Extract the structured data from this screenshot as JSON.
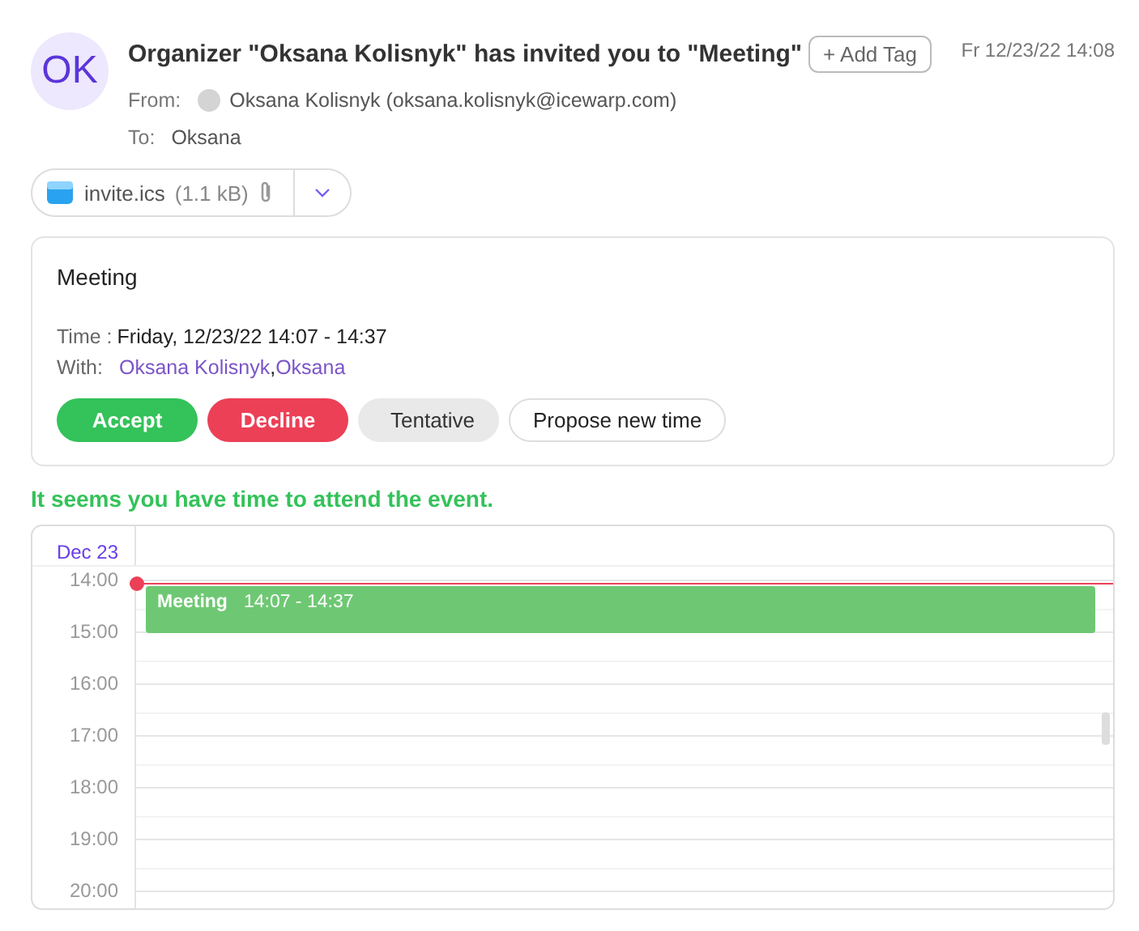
{
  "message": {
    "avatar": "OK",
    "subject": "Organizer \"Oksana Kolisnyk\" has invited you to \"Meeting\"",
    "add_tag": "+ Add Tag",
    "date": "Fr 12/23/22 14:08",
    "from_label": "From:",
    "from": "Oksana Kolisnyk (oksana.kolisnyk@icewarp.com)",
    "to_label": "To:",
    "to": "Oksana"
  },
  "attachment": {
    "name": "invite.ics",
    "size": "(1.1 kB)"
  },
  "invitation": {
    "title": "Meeting",
    "time_label": "Time :",
    "time": "Friday, 12/23/22 14:07 - 14:37",
    "with_label": "With:",
    "attendees": [
      {
        "name": "Oksana Kolisnyk",
        "separator": ","
      },
      {
        "name": "Oksana"
      }
    ],
    "buttons": [
      {
        "label": "Accept",
        "kind": "accept"
      },
      {
        "label": "Decline",
        "kind": "decline"
      },
      {
        "label": "Tentative",
        "kind": "tentative"
      },
      {
        "label": "Propose new time",
        "kind": "propose"
      }
    ]
  },
  "availability": "It seems you have time to attend the event.",
  "calendar": {
    "day": "Dec 23",
    "hours": [
      "14:00",
      "15:00",
      "16:00",
      "17:00",
      "18:00",
      "19:00",
      "20:00"
    ],
    "events": [
      {
        "title": "Meeting",
        "time": "14:07 - 14:37"
      }
    ]
  }
}
